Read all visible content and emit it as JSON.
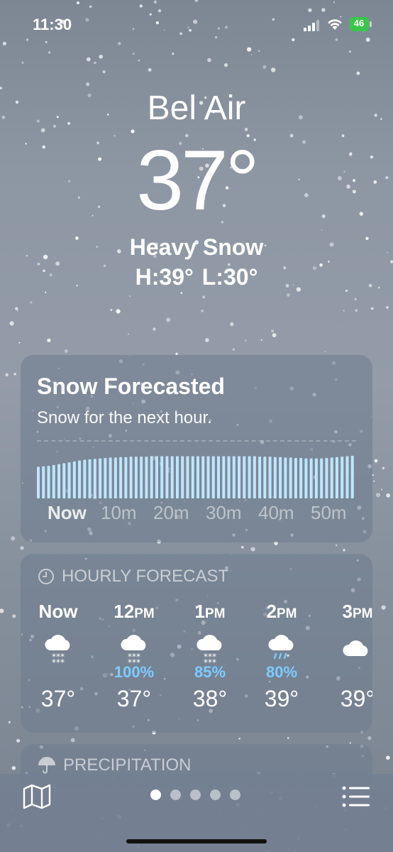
{
  "status_bar": {
    "time": "11:30",
    "battery": "46"
  },
  "location": {
    "city": "Bel Air",
    "temperature": "37°",
    "condition": "Heavy Snow",
    "high": "H:39°",
    "low": "L:30°"
  },
  "snow_card": {
    "title": "Snow Forecasted",
    "subtitle": "Snow for the next hour.",
    "ticks": [
      "Now",
      "10m",
      "20m",
      "30m",
      "40m",
      "50m"
    ],
    "intensity_levels": [
      0.72,
      0.73,
      0.74,
      0.76,
      0.78,
      0.8,
      0.82,
      0.84,
      0.86,
      0.88,
      0.89,
      0.9,
      0.91,
      0.92,
      0.93,
      0.93,
      0.94,
      0.94,
      0.95,
      0.95,
      0.95,
      0.95,
      0.96,
      0.96,
      0.96,
      0.96,
      0.96,
      0.96,
      0.96,
      0.96,
      0.96,
      0.96,
      0.96,
      0.96,
      0.96,
      0.96,
      0.96,
      0.96,
      0.96,
      0.96,
      0.96,
      0.96,
      0.96,
      0.95,
      0.95,
      0.95,
      0.94,
      0.94,
      0.93,
      0.93,
      0.92,
      0.92,
      0.91,
      0.91,
      0.91,
      0.91,
      0.92,
      0.93,
      0.94,
      0.95,
      0.96,
      0.97
    ]
  },
  "hourly": {
    "header": "HOURLY FORECAST",
    "hours": [
      {
        "label": "Now",
        "suffix": "",
        "icon": "snow-cloud-icon",
        "pct": "",
        "temp": "37°"
      },
      {
        "label": "12",
        "suffix": "PM",
        "icon": "snow-cloud-icon",
        "pct": "100%",
        "temp": "37°"
      },
      {
        "label": "1",
        "suffix": "PM",
        "icon": "snow-cloud-icon",
        "pct": "85%",
        "temp": "38°"
      },
      {
        "label": "2",
        "suffix": "PM",
        "icon": "sleet-cloud-icon",
        "pct": "80%",
        "temp": "39°"
      },
      {
        "label": "3",
        "suffix": "PM",
        "icon": "cloud-icon",
        "pct": "",
        "temp": "39°"
      }
    ]
  },
  "precipitation": {
    "header": "PRECIPITATION"
  },
  "colors": {
    "accent_blue": "#7ecbff",
    "battery_green": "#39c64b"
  },
  "page_dots": {
    "count": 5,
    "active": 0
  }
}
